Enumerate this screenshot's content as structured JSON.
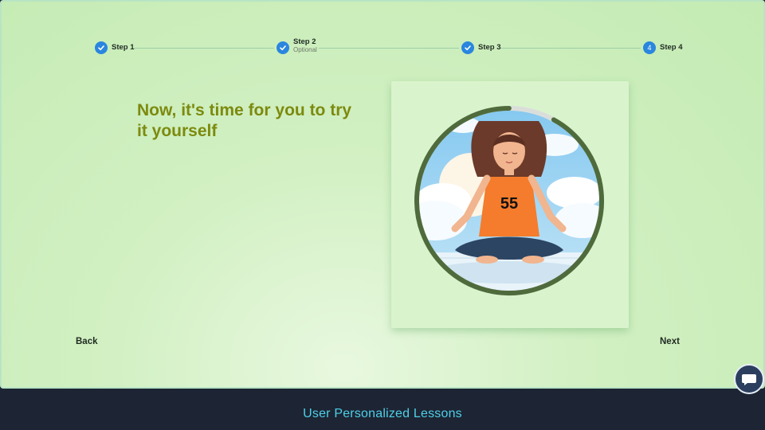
{
  "stepper": {
    "steps": [
      {
        "label": "Step 1",
        "sub": "",
        "state": "complete"
      },
      {
        "label": "Step 2",
        "sub": "Optional",
        "state": "complete"
      },
      {
        "label": "Step 3",
        "sub": "",
        "state": "complete"
      },
      {
        "label": "Step 4",
        "sub": "",
        "state": "active",
        "number": "4"
      }
    ]
  },
  "lesson": {
    "headline": "Now, it's time for you to try it yourself",
    "timer_value": "55",
    "timer_progress": 0.92,
    "illustration": "woman-meditating-lotus-pose"
  },
  "nav": {
    "back_label": "Back",
    "next_label": "Next"
  },
  "chat": {
    "icon": "chat-bubble-icon"
  },
  "footer": {
    "text": "User Personalized Lessons"
  },
  "colors": {
    "accent": "#2a86de",
    "headline": "#7c8a0e",
    "footer_text": "#4ed0e8",
    "footer_bg": "#1d2433"
  }
}
